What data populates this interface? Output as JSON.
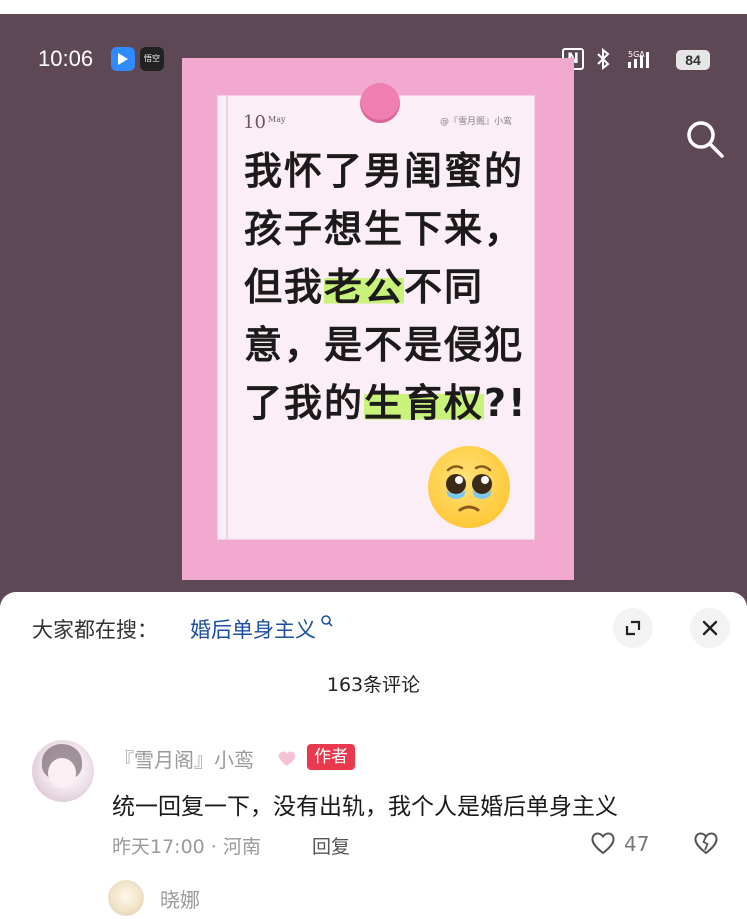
{
  "status_bar": {
    "time": "10:06",
    "app_badge_b": "悟空",
    "nfc": "N",
    "network": "5GA",
    "battery": "84"
  },
  "post": {
    "date_day": "10",
    "date_month": "May",
    "credit": "@『雪月阁』小鸾",
    "headline_lines": [
      [
        "我怀了男闺蜜的"
      ],
      [
        "孩子想生下来，"
      ],
      [
        "但我",
        "老公",
        "不同"
      ],
      [
        "意，是不是侵犯"
      ],
      [
        "了我的",
        "生育权",
        "?!"
      ]
    ],
    "emoji": "pleading-face"
  },
  "sheet": {
    "trending_prefix": "大家都在搜：",
    "trending_term": "婚后单身主义",
    "comments_count": "163条评论"
  },
  "comment": {
    "author": "『雪月阁』小鸾",
    "author_badge": "作者",
    "text": "统一回复一下，没有出轨，我个人是婚后单身主义",
    "meta": "昨天17:00 · 河南",
    "reply_label": "回复",
    "likes": "47"
  },
  "reply_preview": {
    "name": "晓娜"
  },
  "colors": {
    "media_bg": "#5f4856",
    "card_pink": "#f1a9cf",
    "highlight": "#c9f27a",
    "trending_blue": "#1e4fa0",
    "badge_red": "#e8394e"
  }
}
